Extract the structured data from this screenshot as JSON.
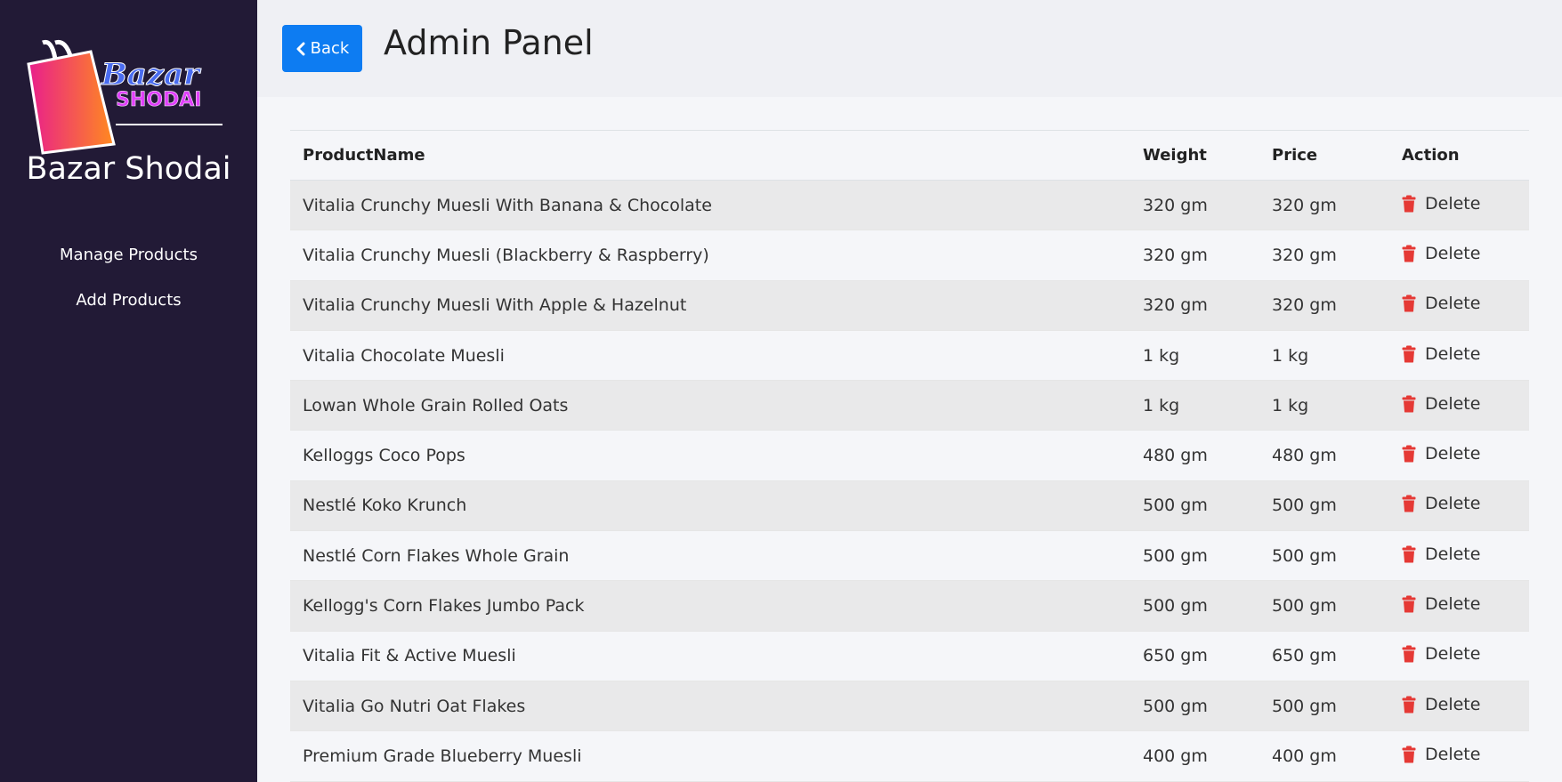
{
  "brand": {
    "logo_text_top": "Bazar",
    "logo_text_bottom": "SHODAI",
    "name": "Bazar Shodai"
  },
  "sidebar": {
    "items": [
      {
        "label": "Manage Products"
      },
      {
        "label": "Add Products"
      }
    ]
  },
  "header": {
    "back_label": "Back",
    "title": "Admin Panel"
  },
  "table": {
    "columns": [
      "ProductName",
      "Weight",
      "Price",
      "Action"
    ],
    "delete_label": "Delete",
    "rows": [
      {
        "name": "Vitalia Crunchy Muesli With Banana & Chocolate",
        "weight": "320 gm",
        "price": "320 gm"
      },
      {
        "name": "Vitalia Crunchy Muesli (Blackberry & Raspberry)",
        "weight": "320 gm",
        "price": "320 gm"
      },
      {
        "name": "Vitalia Crunchy Muesli With Apple & Hazelnut",
        "weight": "320 gm",
        "price": "320 gm"
      },
      {
        "name": "Vitalia Chocolate Muesli",
        "weight": "1 kg",
        "price": "1 kg"
      },
      {
        "name": "Lowan Whole Grain Rolled Oats",
        "weight": "1 kg",
        "price": "1 kg"
      },
      {
        "name": "Kelloggs Coco Pops",
        "weight": "480 gm",
        "price": "480 gm"
      },
      {
        "name": "Nestlé Koko Krunch",
        "weight": "500 gm",
        "price": "500 gm"
      },
      {
        "name": "Nestlé Corn Flakes Whole Grain",
        "weight": "500 gm",
        "price": "500 gm"
      },
      {
        "name": "Kellogg's Corn Flakes Jumbo Pack",
        "weight": "500 gm",
        "price": "500 gm"
      },
      {
        "name": "Vitalia Fit & Active Muesli",
        "weight": "650 gm",
        "price": "650 gm"
      },
      {
        "name": "Vitalia Go Nutri Oat Flakes",
        "weight": "500 gm",
        "price": "500 gm"
      },
      {
        "name": "Premium Grade Blueberry Muesli",
        "weight": "400 gm",
        "price": "400 gm"
      }
    ]
  },
  "colors": {
    "sidebar_bg": "#221a36",
    "back_button": "#0d7cf2",
    "delete_icon": "#e53935",
    "logo_text": "#4a6cf0",
    "logo_subtext": "#e040fb"
  },
  "icons": {
    "back": "chevron-left-icon",
    "delete": "trash-icon",
    "logo": "shopping-bag-icon"
  }
}
